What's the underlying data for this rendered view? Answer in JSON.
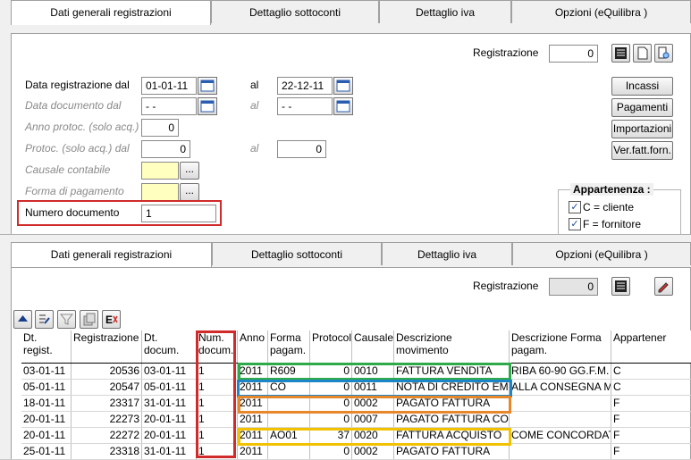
{
  "tabs": [
    "Dati generali registrazioni",
    "Dettaglio sottoconti",
    "Dettaglio iva",
    "Opzioni (eQuilibra )"
  ],
  "top": {
    "registrazione_label": "Registrazione",
    "registrazione_value": "0",
    "data_reg_label": "Data registrazione  dal",
    "data_reg_dal": "01-01-11",
    "al_label": "al",
    "data_reg_al": "22-12-11",
    "data_doc_label": "Data documento    dal",
    "data_doc_dal": "- -",
    "data_doc_al": "- -",
    "anno_protoc_label": "Anno protoc. (solo acq.)",
    "anno_protoc_value": "0",
    "protoc_label": "Protoc. (solo acq.)  dal",
    "protoc_dal": "0",
    "protoc_al": "0",
    "causale_label": "Causale contabile",
    "forma_label": "Forma di pagamento",
    "dots": "...",
    "numero_doc_label": "Numero documento",
    "numero_doc_value": "1",
    "buttons": [
      "Incassi",
      "Pagamenti",
      "Importazioni",
      "Ver.fatt.forn."
    ],
    "appartenenza_title": "Appartenenza :",
    "appartenenza_items": [
      "C = cliente",
      "F = fornitore"
    ]
  },
  "bottom": {
    "registrazione_label": "Registrazione",
    "registrazione_value": "0",
    "columns": [
      "Dt. regist.",
      "Registrazione",
      "Dt. docum.",
      "Num. docum.",
      "Anno",
      "Forma pagam.",
      "Protocol",
      "Causale",
      "Descrizione movimento",
      "Descrizione Forma pagam.",
      "Appartener"
    ],
    "rows": [
      [
        "03-01-11",
        "20536",
        "03-01-11",
        "1",
        "2011",
        "R609",
        "0",
        "0010",
        "FATTURA VENDITA",
        "RIBA 60-90 GG.F.M.",
        "C"
      ],
      [
        "05-01-11",
        "20547",
        "05-01-11",
        "1",
        "2011",
        "CO",
        "0",
        "0011",
        "NOTA DI CREDITO EMI",
        "ALLA CONSEGNA M",
        "C"
      ],
      [
        "18-01-11",
        "23317",
        "31-01-11",
        "1",
        "2011",
        "",
        "0",
        "0002",
        "PAGATO FATTURA",
        "",
        "F"
      ],
      [
        "20-01-11",
        "22273",
        "20-01-11",
        "1",
        "2011",
        "",
        "0",
        "0007",
        "PAGATO FATTURA CO",
        "",
        "F"
      ],
      [
        "20-01-11",
        "22272",
        "20-01-11",
        "1",
        "2011",
        "AO01",
        "37",
        "0020",
        "FATTURA ACQUISTO",
        "COME CONCORDAT",
        "F"
      ],
      [
        "25-01-11",
        "23318",
        "31-01-11",
        "1",
        "2011",
        "",
        "0",
        "0002",
        "PAGATO FATTURA",
        "",
        "F"
      ]
    ]
  },
  "colors": {
    "red": "#d02a2a",
    "green": "#2eaa4a",
    "blue": "#1e86c8",
    "orange": "#e8862a",
    "yellow": "#f2c200"
  }
}
